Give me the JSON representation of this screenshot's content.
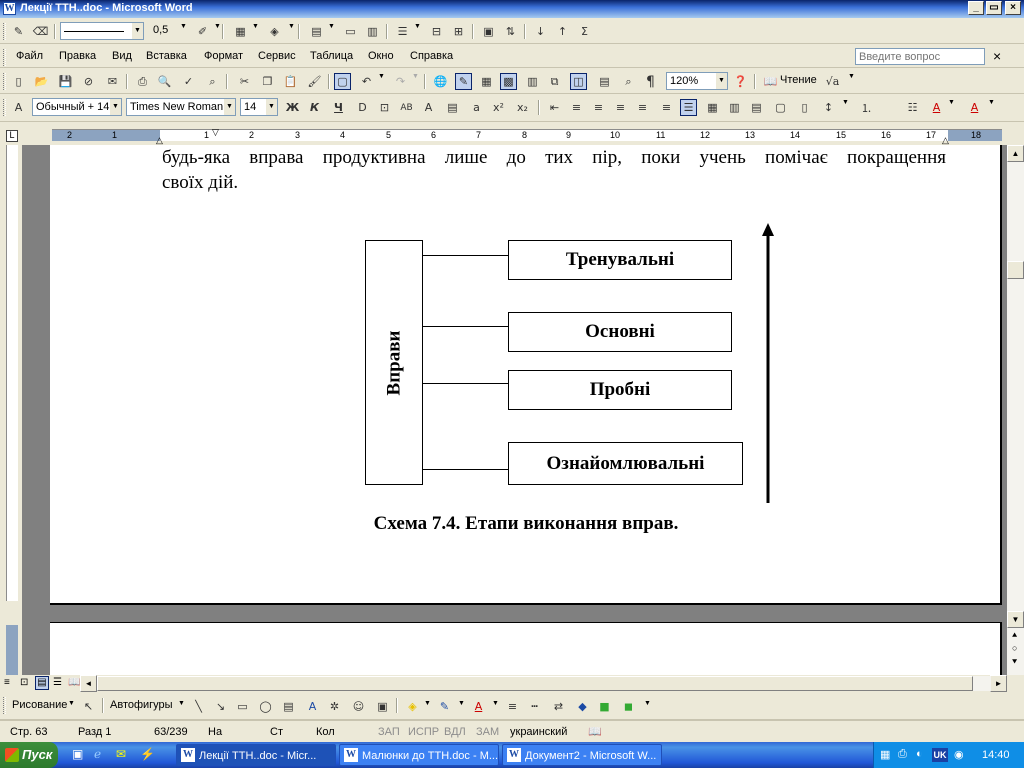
{
  "window": {
    "title": "Лекції ТТН..doc - Microsoft Word",
    "minimize_glyph": "_",
    "maximize_glyph": "▭",
    "close_glyph": "×"
  },
  "drawing_toolbar_top": {
    "line_weight": "0,5"
  },
  "menu": {
    "items": [
      "Файл",
      "Правка",
      "Вид",
      "Вставка",
      "Формат",
      "Сервис",
      "Таблица",
      "Окно",
      "Справка"
    ],
    "question_placeholder": "Введите вопрос",
    "close_glyph": "×"
  },
  "standard_toolbar": {
    "zoom": "120%",
    "reading_label": "Чтение",
    "paragraph_glyph": "¶"
  },
  "format_toolbar": {
    "style": "Обычный + 14",
    "font": "Times New Roman",
    "size": "14",
    "bold": "Ж",
    "italic": "К",
    "underline": "Ч"
  },
  "ruler": {
    "numbers": [
      "2",
      "1",
      "1",
      "2",
      "3",
      "4",
      "5",
      "6",
      "7",
      "8",
      "9",
      "10",
      "11",
      "12",
      "13",
      "14",
      "15",
      "16",
      "17",
      "18"
    ]
  },
  "document": {
    "line1": "будь-яка вправа продуктивна лише до тих пір, поки учень помічає покращення",
    "line2": "своїх дій.",
    "diagram": {
      "left_label": "Вправи",
      "stages": [
        "Тренувальні",
        "Основні",
        "Пробні",
        "Ознайомлювальні"
      ]
    },
    "caption": "Схема 7.4. Етапи виконання вправ."
  },
  "drawing_toolbar": {
    "draw_label": "Рисование",
    "autoshapes_label": "Автофигуры"
  },
  "status": {
    "page": "Стр. 63",
    "section": "Разд 1",
    "pages": "63/239",
    "at": "На",
    "line": "Ст",
    "col": "Кол",
    "rec": "ЗАП",
    "trk": "ИСПР",
    "ext": "ВДЛ",
    "ovr": "ЗАМ",
    "language": "украинский"
  },
  "taskbar": {
    "start_label": "Пуск",
    "tasks": [
      "Лекції ТТН..doc - Micr...",
      "Малюнки до ТТН.doc - M...",
      "Документ2 - Microsoft W..."
    ],
    "language": "UK",
    "clock": "14:40"
  },
  "colors": {
    "title_bar": "#0a246a",
    "taskbar": "#2157d7",
    "start_button": "#3c8f3c"
  }
}
